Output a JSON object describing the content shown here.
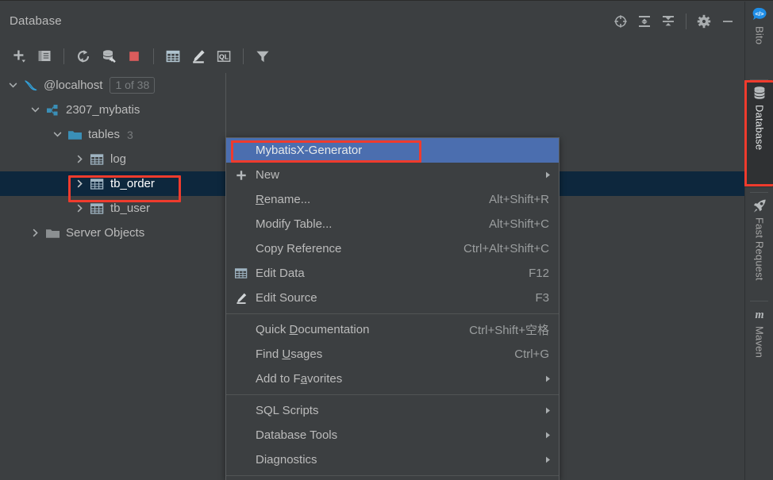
{
  "window": {
    "title": "Database"
  },
  "header_icons": [
    {
      "name": "locate-icon",
      "glyph": "locate"
    },
    {
      "name": "expand-all-icon",
      "glyph": "expand-all"
    },
    {
      "name": "collapse-all-icon",
      "glyph": "collapse-all"
    },
    {
      "name": "settings-gear-icon",
      "glyph": "gear"
    },
    {
      "name": "hide-window-icon",
      "glyph": "minus"
    }
  ],
  "toolbar_items": [
    {
      "name": "add-data-source-button",
      "glyph": "plus-dropdown",
      "tooltip": "New"
    },
    {
      "name": "duplicate-button",
      "glyph": "copy",
      "tooltip": "Duplicate"
    },
    {
      "name": "separator-1",
      "glyph": "sep",
      "tooltip": ""
    },
    {
      "name": "refresh-button",
      "glyph": "refresh",
      "tooltip": "Refresh"
    },
    {
      "name": "data-source-properties-button",
      "glyph": "db-wrench",
      "tooltip": "Properties"
    },
    {
      "name": "stop-button",
      "glyph": "stop",
      "tooltip": "Stop"
    },
    {
      "name": "separator-2",
      "glyph": "sep",
      "tooltip": ""
    },
    {
      "name": "edit-data-button",
      "glyph": "table",
      "tooltip": "Edit Data"
    },
    {
      "name": "edit-source-button",
      "glyph": "pencil",
      "tooltip": "Edit Source"
    },
    {
      "name": "open-console-button",
      "glyph": "ql",
      "tooltip": "Open Console"
    },
    {
      "name": "separator-3",
      "glyph": "sep",
      "tooltip": ""
    },
    {
      "name": "filter-button",
      "glyph": "funnel",
      "tooltip": "Filter"
    }
  ],
  "tree": {
    "rows": [
      {
        "name": "tree-item-localhost",
        "label": "@localhost",
        "indent": 0,
        "twisty": "down",
        "icon": "mysql-dolphin-icon",
        "badge": "1 of 38",
        "count": "",
        "selected": false
      },
      {
        "name": "tree-item-2307-mybatis",
        "label": "2307_mybatis",
        "indent": 1,
        "twisty": "down",
        "icon": "schema-icon",
        "badge": "",
        "count": "",
        "selected": false
      },
      {
        "name": "tree-item-tables",
        "label": "tables",
        "indent": 2,
        "twisty": "down",
        "icon": "folder-icon",
        "badge": "",
        "count": "3",
        "selected": false
      },
      {
        "name": "tree-item-log",
        "label": "log",
        "indent": 3,
        "twisty": "right",
        "icon": "table-icon",
        "badge": "",
        "count": "",
        "selected": false
      },
      {
        "name": "tree-item-tb-order",
        "label": "tb_order",
        "indent": 3,
        "twisty": "right",
        "icon": "table-icon",
        "badge": "",
        "count": "",
        "selected": true
      },
      {
        "name": "tree-item-tb-user",
        "label": "tb_user",
        "indent": 3,
        "twisty": "right",
        "icon": "table-icon",
        "badge": "",
        "count": "",
        "selected": false
      },
      {
        "name": "tree-item-server-objects",
        "label": "Server Objects",
        "indent": 1,
        "twisty": "right",
        "icon": "folder-grey-icon",
        "badge": "",
        "count": "",
        "selected": false
      }
    ]
  },
  "context_menu": {
    "items": [
      {
        "name": "menu-item-mybatisx-generator",
        "label": "MybatisX-Generator",
        "shortcut": "",
        "icon": "",
        "arrow": false,
        "highlight": true,
        "separator_after": false
      },
      {
        "name": "menu-item-new",
        "label": "New",
        "shortcut": "",
        "icon": "plus",
        "arrow": true,
        "highlight": false,
        "separator_after": false
      },
      {
        "name": "menu-item-rename",
        "label": "Rename...",
        "mnemonic": "R",
        "shortcut": "Alt+Shift+R",
        "icon": "",
        "arrow": false,
        "highlight": false,
        "separator_after": false
      },
      {
        "name": "menu-item-modify-table",
        "label": "Modify Table...",
        "shortcut": "Alt+Shift+C",
        "icon": "",
        "arrow": false,
        "highlight": false,
        "separator_after": false
      },
      {
        "name": "menu-item-copy-reference",
        "label": "Copy Reference",
        "shortcut": "Ctrl+Alt+Shift+C",
        "icon": "",
        "arrow": false,
        "highlight": false,
        "separator_after": false
      },
      {
        "name": "menu-item-edit-data",
        "label": "Edit Data",
        "shortcut": "F12",
        "icon": "table",
        "arrow": false,
        "highlight": false,
        "separator_after": false
      },
      {
        "name": "menu-item-edit-source",
        "label": "Edit Source",
        "shortcut": "F3",
        "icon": "pencil",
        "arrow": false,
        "highlight": false,
        "separator_after": true
      },
      {
        "name": "menu-item-quick-documentation",
        "label": "Quick Documentation",
        "mnemonic": "D",
        "shortcut": "Ctrl+Shift+空格",
        "icon": "",
        "arrow": false,
        "highlight": false,
        "separator_after": false
      },
      {
        "name": "menu-item-find-usages",
        "label": "Find Usages",
        "mnemonic": "U",
        "shortcut": "Ctrl+G",
        "icon": "",
        "arrow": false,
        "highlight": false,
        "separator_after": false
      },
      {
        "name": "menu-item-add-to-favorites",
        "label": "Add to Favorites",
        "mnemonic": "F",
        "shortcut": "",
        "icon": "",
        "arrow": true,
        "highlight": false,
        "separator_after": true
      },
      {
        "name": "menu-item-sql-scripts",
        "label": "SQL Scripts",
        "shortcut": "",
        "icon": "",
        "arrow": true,
        "highlight": false,
        "separator_after": false
      },
      {
        "name": "menu-item-database-tools",
        "label": "Database Tools",
        "shortcut": "",
        "icon": "",
        "arrow": true,
        "highlight": false,
        "separator_after": false
      },
      {
        "name": "menu-item-diagnostics",
        "label": "Diagnostics",
        "shortcut": "",
        "icon": "",
        "arrow": true,
        "highlight": false,
        "separator_after": true
      }
    ]
  },
  "tool_stripe": {
    "buttons": [
      {
        "name": "stripe-button-bito",
        "label": "Bito",
        "icon": "bito-icon",
        "active": false,
        "highlighted": false
      },
      {
        "name": "stripe-button-database",
        "label": "Database",
        "icon": "database-icon",
        "active": true,
        "highlighted": true
      },
      {
        "name": "stripe-button-fast-request",
        "label": "Fast Request",
        "icon": "rocket-icon",
        "active": false,
        "highlighted": false
      },
      {
        "name": "stripe-button-maven",
        "label": "Maven",
        "icon": "maven-icon",
        "active": false,
        "highlighted": false
      }
    ]
  },
  "colors": {
    "background": "#3c3f41",
    "selection_tree": "#0d273d",
    "selection_menu": "#4b6eaf",
    "annotation_red": "#ef3b2d",
    "text": "#bbbbbb",
    "accent_blue": "#3592c4"
  }
}
